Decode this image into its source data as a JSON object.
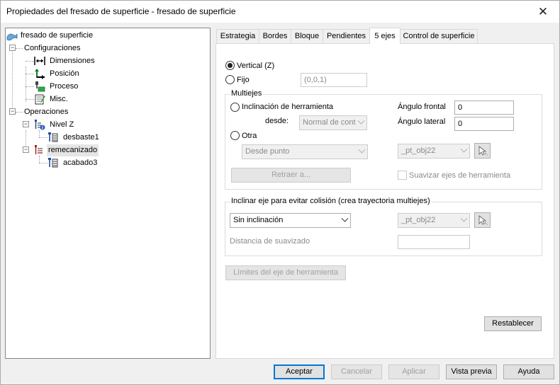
{
  "window": {
    "title": "Propiedades del fresado de superficie - fresado de superficie",
    "close_glyph": "✕"
  },
  "tree": {
    "root": "fresado de superficie",
    "configuraciones": "Configuraciones",
    "dimensiones": "Dimensiones",
    "posicion": "Posición",
    "proceso": "Proceso",
    "misc": "Misc.",
    "operaciones": "Operaciones",
    "nivel_z": "Nivel Z",
    "desbaste1": "desbaste1",
    "remecanizado": "remecanizado",
    "acabado3": "acabado3"
  },
  "tabs": [
    "Estrategia",
    "Bordes",
    "Bloque",
    "Pendientes",
    "5 ejes",
    "Control de superficie"
  ],
  "active_tab": "5 ejes",
  "five_axis": {
    "vertical_label": "Vertical (Z)",
    "fijo_label": "Fijo",
    "fijo_value": "(0,0,1)",
    "multiejes_legend": "Multiejes",
    "inclinacion_label": "Inclinación de herramienta",
    "desde_label": "desde:",
    "desde_value": "Normal de cont",
    "angulo_frontal_label": "Ángulo frontal",
    "angulo_frontal_value": "0",
    "angulo_lateral_label": "Ángulo lateral",
    "angulo_lateral_value": "0",
    "otra_label": "Otra",
    "desde_punto_value": "Desde punto",
    "pt_obj_value": "_pt_obj22",
    "retraer_label": "Retraer a...",
    "suavizar_label": "Suavizar ejes de herramienta",
    "colision_legend": "Inclinar eje para evitar colisión (crea trayectoria multiejes)",
    "sin_inclinacion_value": "Sin inclinación",
    "pt_obj2_value": "_pt_obj22",
    "distancia_label": "Distancia de suavizado",
    "distancia_value": "",
    "limites_label": "Límites del eje de herramienta",
    "restablecer_label": "Restablecer"
  },
  "footer": {
    "aceptar": "Aceptar",
    "cancelar": "Cancelar",
    "aplicar": "Aplicar",
    "vista_previa": "Vista previa",
    "ayuda": "Ayuda"
  }
}
